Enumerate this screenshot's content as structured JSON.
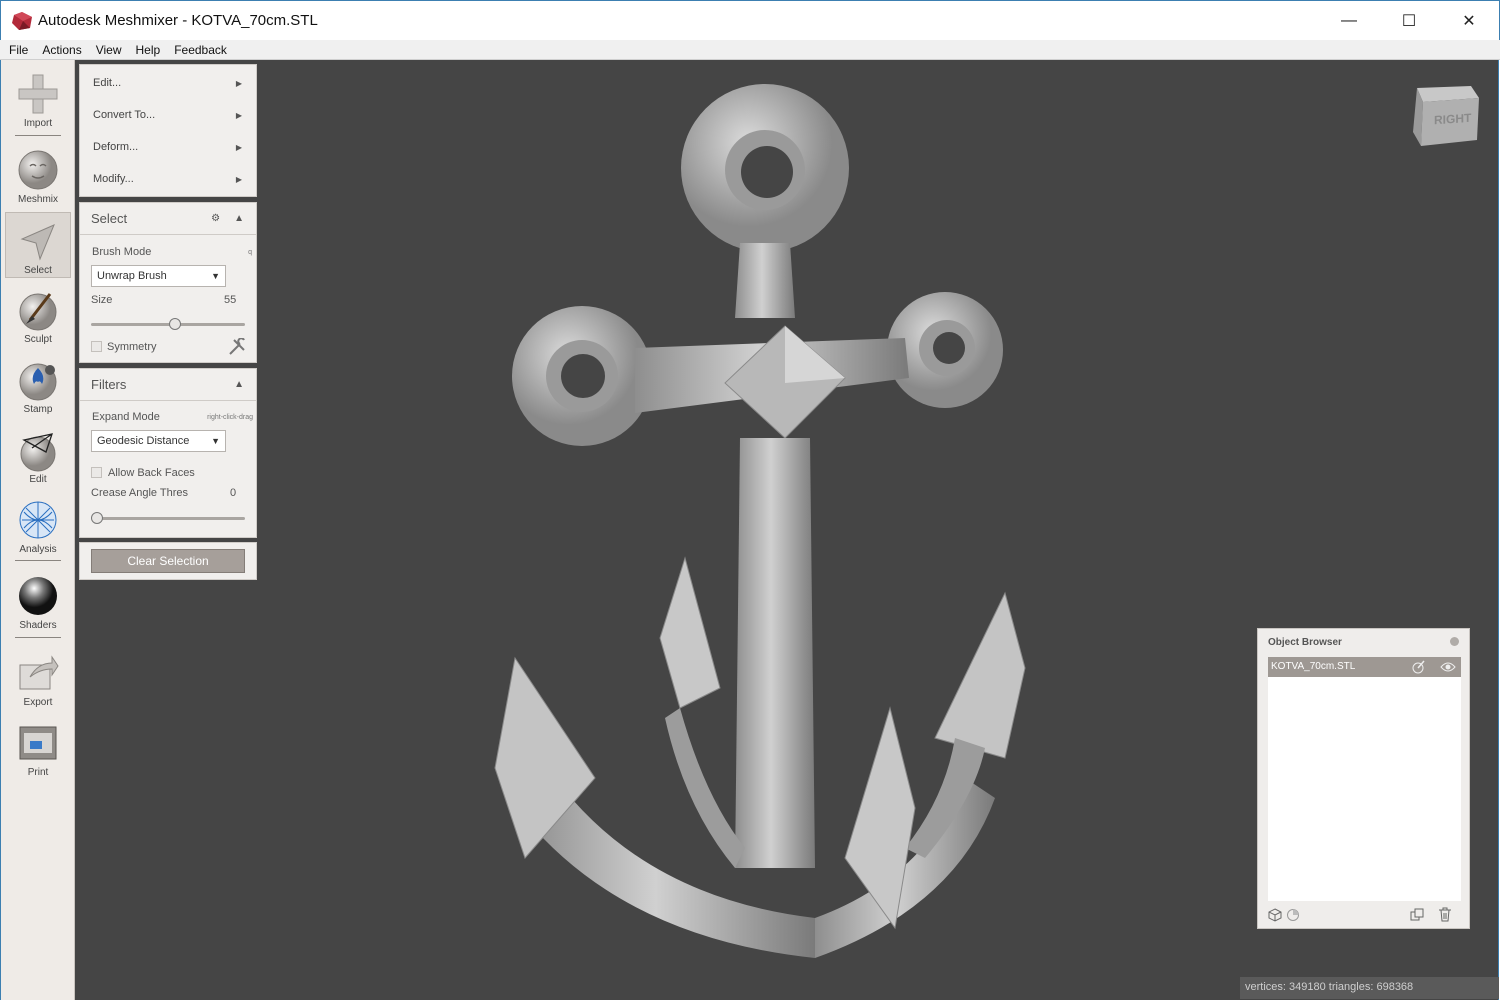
{
  "window": {
    "title": "Autodesk Meshmixer - KOTVA_70cm.STL",
    "minimize_glyph": "—",
    "maximize_glyph": "☐",
    "close_glyph": "✕"
  },
  "menu": {
    "items": [
      "File",
      "Actions",
      "View",
      "Help",
      "Feedback"
    ]
  },
  "toolbar": {
    "tools": [
      {
        "label": "Import",
        "icon": "import-plus-icon"
      },
      {
        "label": "Meshmix",
        "icon": "meshmix-bunny-icon"
      },
      {
        "label": "Select",
        "icon": "select-arrow-icon"
      },
      {
        "label": "Sculpt",
        "icon": "sculpt-brush-icon"
      },
      {
        "label": "Stamp",
        "icon": "stamp-icon"
      },
      {
        "label": "Edit",
        "icon": "edit-icon"
      },
      {
        "label": "Analysis",
        "icon": "analysis-icon"
      },
      {
        "label": "Shaders",
        "icon": "shaders-sphere-icon"
      },
      {
        "label": "Export",
        "icon": "export-icon"
      },
      {
        "label": "Print",
        "icon": "print-icon"
      }
    ]
  },
  "actions_menu": {
    "items": [
      "Edit...",
      "Convert To...",
      "Deform...",
      "Modify..."
    ],
    "arrow_glyph": "▶"
  },
  "select_panel": {
    "title": "Select",
    "brush_mode_label": "Brush Mode",
    "brush_mode_hint": "q",
    "brush_mode_value": "Unwrap Brush",
    "size_label": "Size",
    "size_value": "55",
    "size_fraction": 0.55,
    "symmetry_label": "Symmetry",
    "symmetry_checked": false
  },
  "filters_panel": {
    "title": "Filters",
    "expand_mode_label": "Expand Mode",
    "expand_mode_hint": "right-click-drag",
    "expand_mode_value": "Geodesic Distance",
    "allow_back_faces_label": "Allow Back Faces",
    "allow_back_faces_checked": false,
    "crease_angle_label": "Crease Angle Thres",
    "crease_angle_value": "0",
    "crease_angle_fraction": 0
  },
  "clear_selection_label": "Clear Selection",
  "viewcube": {
    "face_label": "RIGHT"
  },
  "object_browser": {
    "title": "Object Browser",
    "objects": [
      "KOTVA_70cm.STL"
    ]
  },
  "status": {
    "text": "vertices: 349180 triangles: 698368"
  },
  "colors": {
    "viewport_bg": "#454545",
    "panel_bg": "#f1efed",
    "button_accent": "#a69f9a",
    "window_border": "#3c7fb1"
  }
}
